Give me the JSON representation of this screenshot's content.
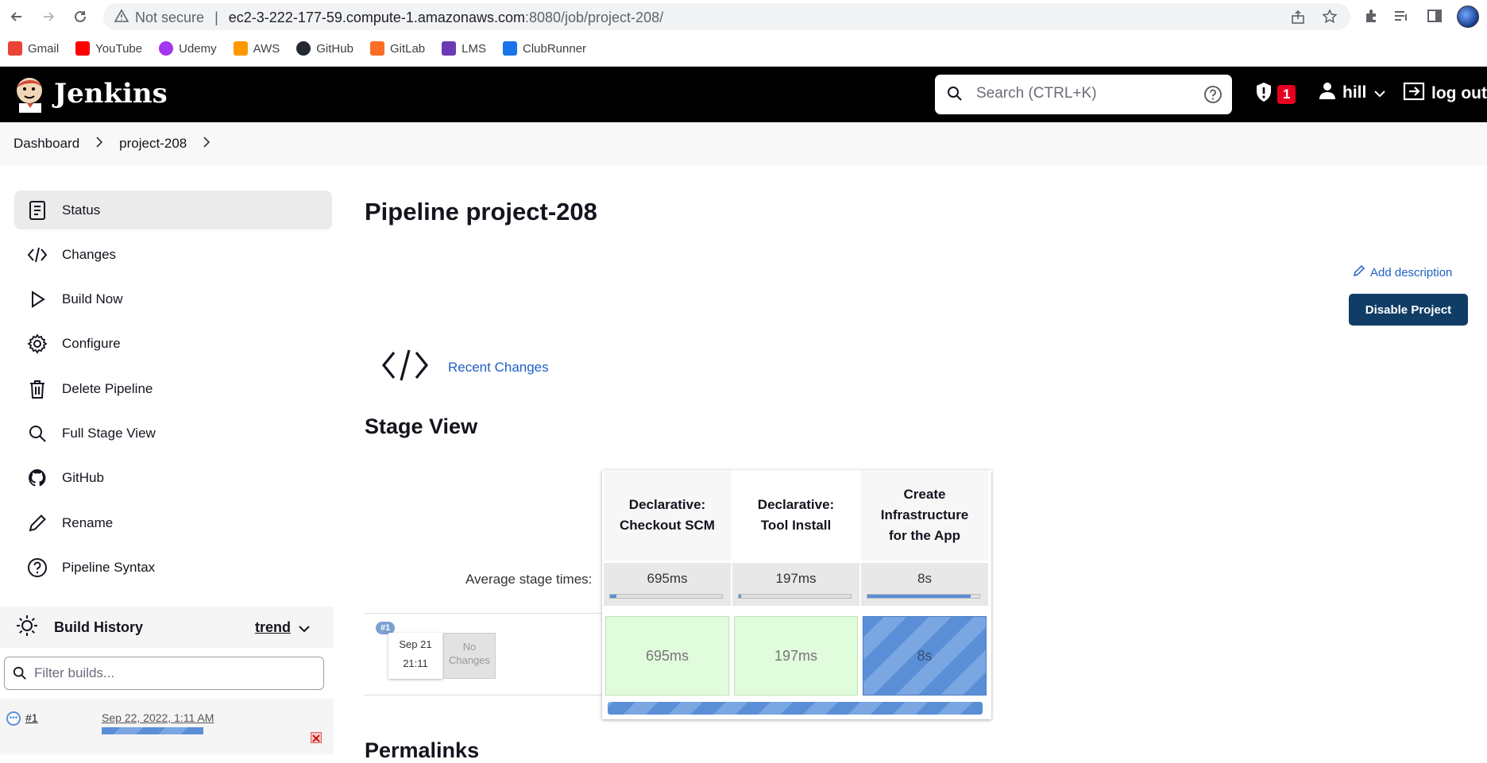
{
  "browser": {
    "security_label": "Not secure",
    "url_host": "ec2-3-222-177-59.compute-1.amazonaws.com",
    "url_rest": ":8080/job/project-208/",
    "bookmarks": [
      {
        "label": "Gmail",
        "icon": "gmail-icon",
        "color": "#ea4335"
      },
      {
        "label": "YouTube",
        "icon": "youtube-icon",
        "color": "#ff0000"
      },
      {
        "label": "Udemy",
        "icon": "udemy-icon",
        "color": "#a435f0"
      },
      {
        "label": "AWS",
        "icon": "aws-icon",
        "color": "#ff9900"
      },
      {
        "label": "GitHub",
        "icon": "github-icon",
        "color": "#24292f"
      },
      {
        "label": "GitLab",
        "icon": "gitlab-icon",
        "color": "#fc6d26"
      },
      {
        "label": "LMS",
        "icon": "lms-icon",
        "color": "#6a3bb5"
      },
      {
        "label": "ClubRunner",
        "icon": "clubrunner-icon",
        "color": "#1a73e8"
      }
    ]
  },
  "header": {
    "app_title": "Jenkins",
    "search_placeholder": "Search (CTRL+K)",
    "security_count": "1",
    "user": "hill",
    "logout": "log out"
  },
  "breadcrumb": [
    "Dashboard",
    "project-208"
  ],
  "sidebar": {
    "tasks": [
      {
        "label": "Status",
        "icon": "status-icon",
        "active": true
      },
      {
        "label": "Changes",
        "icon": "code-icon"
      },
      {
        "label": "Build Now",
        "icon": "play-icon"
      },
      {
        "label": "Configure",
        "icon": "gear-icon"
      },
      {
        "label": "Delete Pipeline",
        "icon": "trash-icon"
      },
      {
        "label": "Full Stage View",
        "icon": "search-icon"
      },
      {
        "label": "GitHub",
        "icon": "github-icon"
      },
      {
        "label": "Rename",
        "icon": "pencil-icon"
      },
      {
        "label": "Pipeline Syntax",
        "icon": "help-icon"
      }
    ],
    "build_history": {
      "title": "Build History",
      "trend_label": "trend",
      "filter_placeholder": "Filter builds...",
      "builds": [
        {
          "number": "#1",
          "date": "Sep 22, 2022, 1:11 AM"
        }
      ]
    }
  },
  "main": {
    "title": "Pipeline project-208",
    "add_description": "Add description",
    "disable_button": "Disable Project",
    "recent_changes": "Recent Changes",
    "stage_view_title": "Stage View",
    "avg_label": "Average stage times:",
    "stages": [
      {
        "name_line1": "Declarative:",
        "name_line2": "Checkout SCM",
        "name_line3": "",
        "avg": "695ms",
        "avg_fraction": 0.06,
        "run": "695ms",
        "status": "success"
      },
      {
        "name_line1": "Declarative:",
        "name_line2": "Tool Install",
        "name_line3": "",
        "avg": "197ms",
        "avg_fraction": 0.02,
        "run": "197ms",
        "status": "success"
      },
      {
        "name_line1": "Create",
        "name_line2": "Infrastructure",
        "name_line3": "for the App",
        "avg": "8s",
        "avg_fraction": 0.92,
        "run": "8s",
        "status": "running"
      }
    ],
    "run": {
      "number": "#1",
      "date": "Sep 21",
      "time": "21:11",
      "changes_line1": "No",
      "changes_line2": "Changes"
    },
    "permalinks_title": "Permalinks"
  },
  "colors": {
    "header_bg": "#000000",
    "link": "#1f5ec7",
    "primary_button": "#0f3d66",
    "success_cell": "#e1fbdd",
    "running": "#5a8fd8",
    "badge": "#e6001f"
  }
}
